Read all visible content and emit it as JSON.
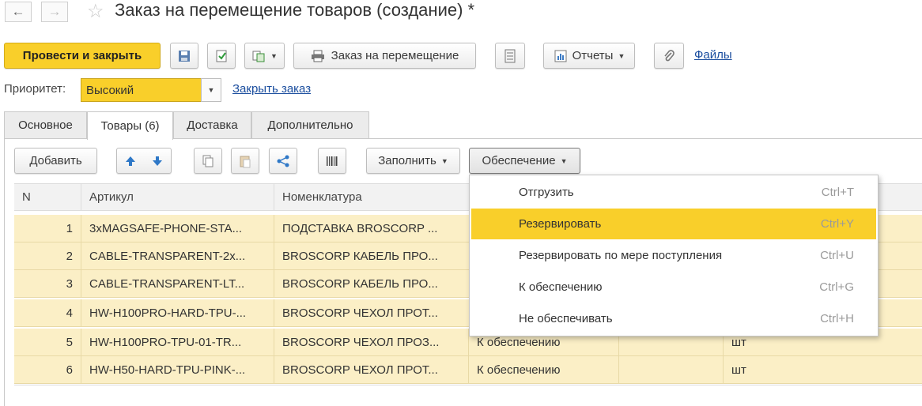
{
  "header": {
    "back_icon": "arrow-left-icon",
    "forward_icon": "arrow-right-icon",
    "favorite_icon": "star-icon",
    "title": "Заказ на перемещение товаров (создание) *"
  },
  "toolbar": {
    "post_close_label": "Провести и закрыть",
    "move_order_label": "Заказ на перемещение",
    "reports_label": "Отчеты",
    "files_label": "Файлы"
  },
  "priority": {
    "label": "Приоритет:",
    "value": "Высокий",
    "close_order_link": "Закрыть заказ"
  },
  "tabs": [
    {
      "label": "Основное"
    },
    {
      "label": "Товары (6)"
    },
    {
      "label": "Доставка"
    },
    {
      "label": "Дополнительно"
    }
  ],
  "grid_toolbar": {
    "add_label": "Добавить",
    "fill_label": "Заполнить",
    "supply_label": "Обеспечение"
  },
  "table": {
    "columns": [
      "N",
      "Артикул",
      "Номенклатура"
    ],
    "rows": [
      {
        "n": "1",
        "article": "3xMAGSAFE-PHONE-STA...",
        "name": "ПОДСТАВКА BROSCORP ...",
        "supply": "",
        "unit": ""
      },
      {
        "n": "2",
        "article": "CABLE-TRANSPARENT-2x...",
        "name": "BROSCORP КАБЕЛЬ ПРО...",
        "supply": "",
        "unit": ""
      },
      {
        "n": "3",
        "article": "CABLE-TRANSPARENT-LT...",
        "name": "BROSCORP КАБЕЛЬ ПРО...",
        "supply": "",
        "unit": ""
      },
      {
        "n": "4",
        "article": "HW-H100PRO-HARD-TPU-...",
        "name": "BROSCORP ЧЕХОЛ ПРОТ...",
        "supply": "",
        "unit": ""
      },
      {
        "n": "5",
        "article": "HW-H100PRO-TPU-01-TR...",
        "name": "BROSCORP ЧЕХОЛ ПРОЗ...",
        "supply": "К обеспечению",
        "unit": "шт"
      },
      {
        "n": "6",
        "article": "HW-H50-HARD-TPU-PINK-...",
        "name": "BROSCORP ЧЕХОЛ ПРОТ...",
        "supply": "К обеспечению",
        "unit": "шт"
      }
    ]
  },
  "supply_menu": {
    "items": [
      {
        "label": "Отгрузить",
        "shortcut": "Ctrl+T"
      },
      {
        "label": "Резервировать",
        "shortcut": "Ctrl+Y",
        "highlighted": true
      },
      {
        "label": "Резервировать по мере поступления",
        "shortcut": "Ctrl+U"
      },
      {
        "label": "К обеспечению",
        "shortcut": "Ctrl+G"
      },
      {
        "label": "Не обеспечивать",
        "shortcut": "Ctrl+H"
      }
    ]
  },
  "colors": {
    "accent_yellow": "#f9cf2a",
    "row_highlight": "#fbefc6",
    "link_blue": "#1a4d9e"
  }
}
